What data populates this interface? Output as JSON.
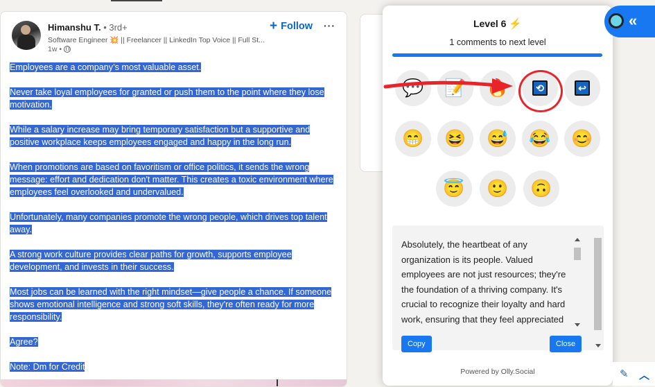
{
  "post": {
    "author_name": "Himanshu T.",
    "author_degree": " • 3rd+",
    "author_headline": "Software Engineer 💥 || Freelancer || LinkedIn Top Voice || Full St...",
    "time": "1w •",
    "follow_label": "Follow",
    "more_label": "···",
    "paragraphs": [
      "Employees are a company’s most valuable asset.",
      "Never take loyal employees for granted or push them to the point where they lose motivation.",
      "While a salary increase may bring temporary satisfaction but a supportive and positive workplace keeps employees engaged and happy in the long run.",
      "When promotions are based on favoritism or office politics, it sends the wrong message: effort and dedication don't matter. This creates a toxic environment where employees feel overlooked and undervalued.",
      "Unfortunately, many companies promote the wrong people, which drives top talent away.",
      "A strong work culture provides clear paths for growth, supports employee development, and invests in their success.",
      "Most jobs can be learned with the right mindset—give people a chance. If someone shows emotional intelligence and strong soft skills, they're often ready for more responsibility.",
      "Agree?",
      "Note: Dm for Credit"
    ]
  },
  "panel": {
    "level_title": "Level 6",
    "level_icon": "⚡",
    "next_level": "1 comments to next level",
    "progress_fraction": 1.0,
    "actions_row1": [
      {
        "name": "comment-icon",
        "glyph": "💬"
      },
      {
        "name": "note-icon",
        "glyph": "📝"
      },
      {
        "name": "fire-icon",
        "glyph": "🔥"
      },
      {
        "name": "regenerate-icon",
        "glyph": "🔄"
      },
      {
        "name": "return-icon",
        "glyph": "↩"
      }
    ],
    "emojis_row2": [
      "😁",
      "😆",
      "😅",
      "😂",
      "😊"
    ],
    "emojis_row3": [
      "😇",
      "🙂",
      "🙃"
    ],
    "reply_text": "Absolutely, the heartbeat of any organization is its people. Valued employees are not just resources; they're the foundation of a thriving company. It's crucial to recognize their loyalty and hard work, ensuring that they feel appreciated and motivated every single day.",
    "copy_label": "Copy",
    "close_label": "Close",
    "powered_by": "Powered by Olly.Social"
  },
  "colors": {
    "linkedin_blue": "#0a66c2",
    "olly_blue": "#1778f2",
    "selection": "#3367d6",
    "annotation_red": "#e8232a"
  }
}
